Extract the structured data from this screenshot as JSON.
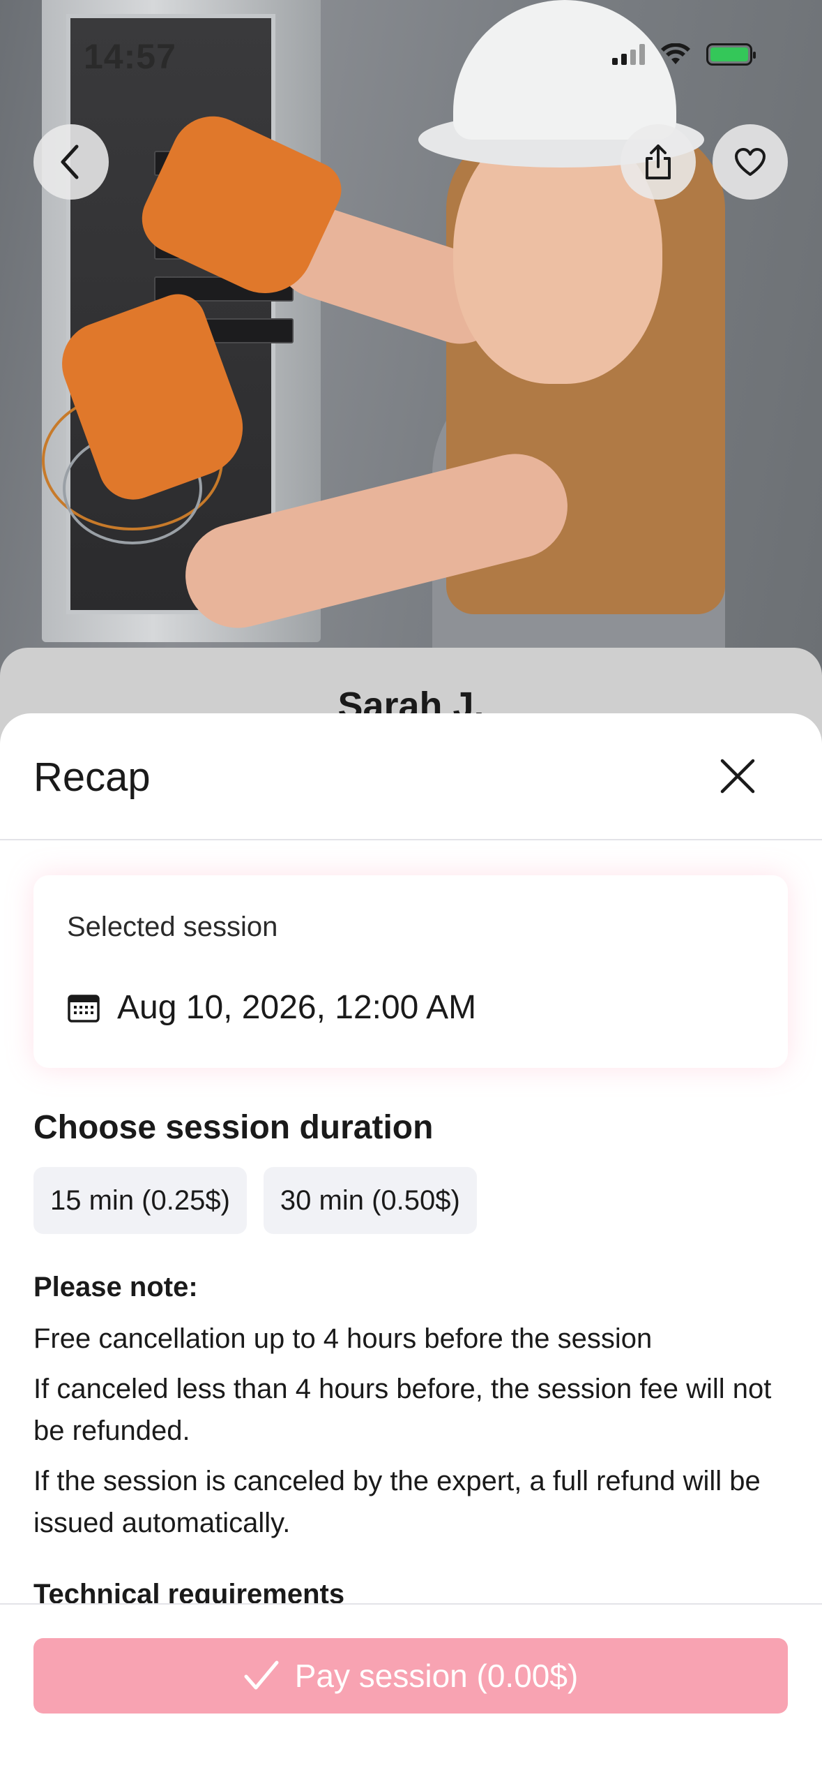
{
  "status_bar": {
    "time": "14:57"
  },
  "hero": {
    "back_icon": "chevron-left-icon",
    "share_icon": "share-icon",
    "favorite_icon": "heart-icon"
  },
  "profile": {
    "name": "Sarah J."
  },
  "recap": {
    "title": "Recap",
    "close_icon": "close-icon",
    "selected_session": {
      "label": "Selected session",
      "calendar_icon": "calendar-icon",
      "date": "Aug 10, 2026, 12:00 AM"
    },
    "duration": {
      "title": "Choose session duration",
      "options": [
        {
          "label": "15 min (0.25$)"
        },
        {
          "label": "30 min (0.50$)"
        }
      ]
    },
    "note": {
      "title": "Please note:",
      "lines": [
        "Free cancellation up to 4 hours before the session",
        "If canceled less than 4 hours before, the session fee will not be refunded.",
        "If the session is canceled by the expert, a full refund will be issued automatically."
      ]
    },
    "technical_requirements_title": "Technical requirements"
  },
  "footer": {
    "pay_label": "Pay session (0.00$)",
    "check_icon": "checkmark-icon"
  },
  "colors": {
    "accent_pink": "#f8a3b2",
    "chip_bg": "#f1f2f6",
    "under_card": "#cfcfcf"
  }
}
